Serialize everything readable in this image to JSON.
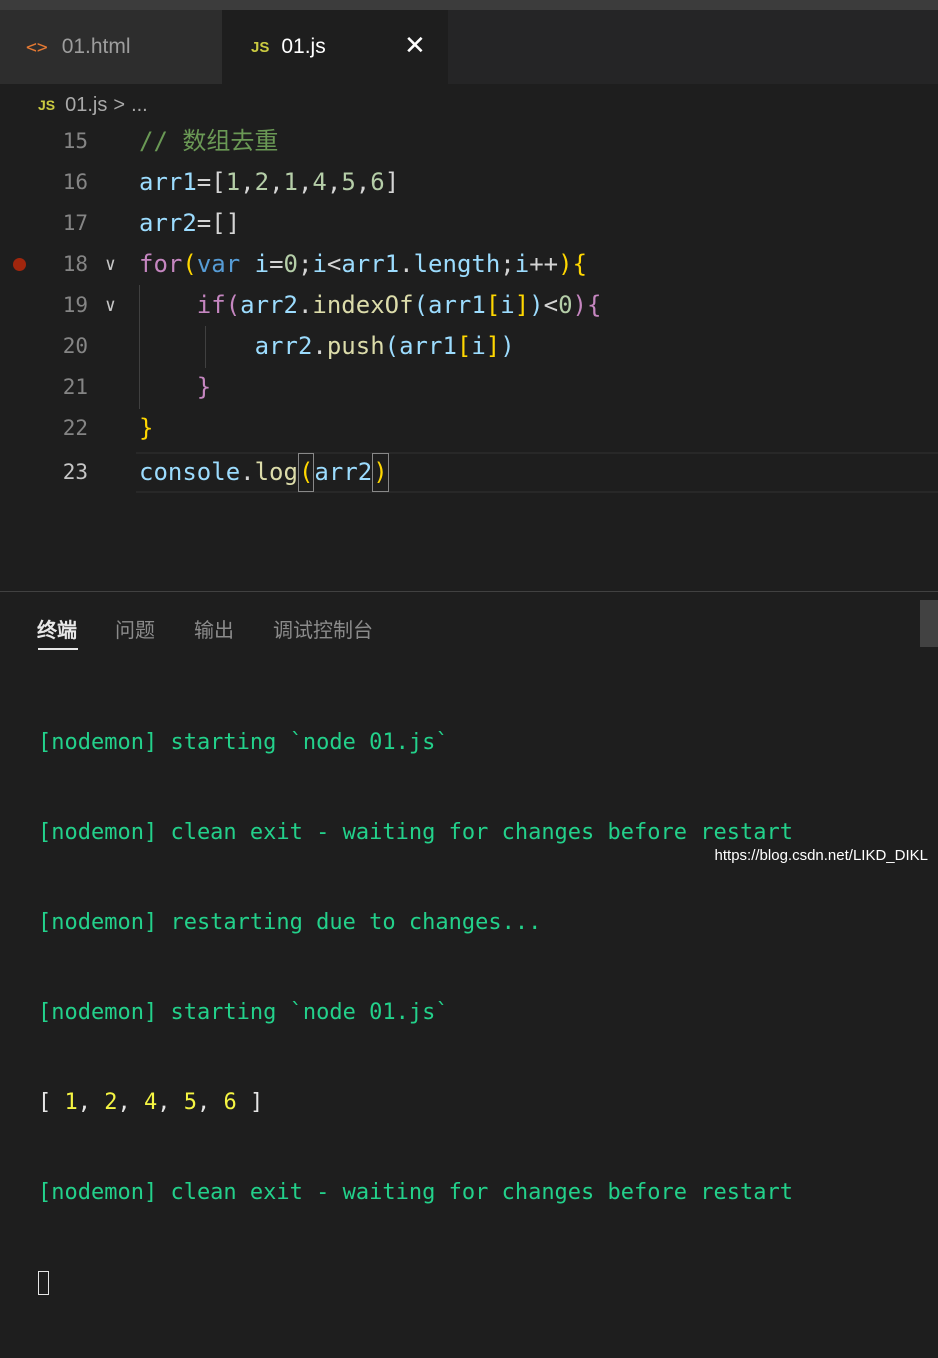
{
  "tabs": [
    {
      "icon": "html-icon",
      "label": "01.html"
    },
    {
      "icon": "js-icon",
      "icon_text": "JS",
      "label": "01.js"
    }
  ],
  "close_glyph": "✕",
  "breadcrumb": {
    "icon_text": "JS",
    "file": "01.js",
    "separator": ">",
    "rest": "..."
  },
  "editor": {
    "line_numbers": [
      "15",
      "16",
      "17",
      "18",
      "19",
      "20",
      "21",
      "22",
      "23"
    ],
    "lines": [
      "// 数组去重",
      "arr1=[1,2,1,4,5,6]",
      "arr2=[]",
      "for(var i=0;i<arr1.length;i++){",
      "    if(arr2.indexOf(arr1[i])<0){",
      "        arr2.push(arr1[i])",
      "    }",
      "}",
      "console.log(arr2)"
    ],
    "active_line": "23",
    "breakpoint_line": "18"
  },
  "panel": {
    "tabs": [
      "终端",
      "问题",
      "输出",
      "调试控制台"
    ],
    "active_tab": "终端"
  },
  "terminal": {
    "lines": [
      "[nodemon] starting `node 01.js`",
      "[nodemon] clean exit - waiting for changes before restart",
      "[nodemon] restarting due to changes...",
      "[nodemon] starting `node 01.js`",
      "[ 1, 2, 4, 5, 6 ]",
      "[nodemon] clean exit - waiting for changes before restart"
    ]
  },
  "watermark": "https://blog.csdn.net/LIKD_DIKL",
  "colors": {
    "background": "#1e1e1e",
    "keyword": "#569cd6",
    "control": "#c586c0",
    "variable": "#9cdcfe",
    "number": "#b5cea8",
    "function": "#dcdcaa",
    "comment": "#6a9955",
    "terminal_green": "#23d18b",
    "terminal_yellow": "#f5f543"
  }
}
